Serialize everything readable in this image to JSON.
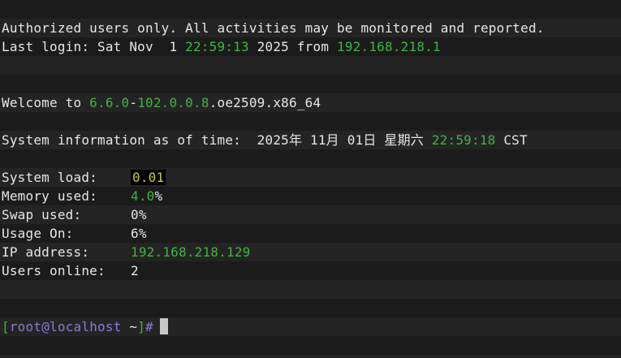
{
  "banner": {
    "warning": "Authorized users only. All activities may be monitored and reported.",
    "last_login_prefix": "Last login: Sat Nov  1 ",
    "last_login_time": "22:59:13",
    "last_login_mid": " 2025 from ",
    "last_login_ip": "192.168.218.1"
  },
  "welcome": {
    "prefix": "Welcome to ",
    "kernel_a": "6.6.0",
    "sep1": "-",
    "kernel_b": "102.0.0.8",
    "suffix": ".oe2509.x86_64"
  },
  "sysinfo": {
    "prefix": "System information as of time:  2025年 11月 01日 星期六 ",
    "time": "22:59:18",
    "tz": " CST"
  },
  "stats": {
    "load_label": "System load:",
    "load_value": "0.01",
    "memory_label": "Memory used:",
    "memory_value": "4.0",
    "memory_unit": "%",
    "swap_label": "Swap used:",
    "swap_value": "0%",
    "usage_label": "Usage On:",
    "usage_value": "6%",
    "ip_label": "IP address:",
    "ip_value": "192.168.218.129",
    "users_label": "Users online:",
    "users_value": "2"
  },
  "prompt": {
    "open": "[",
    "user": "root",
    "at": "@",
    "host": "localhost",
    "path": " ~",
    "close": "]",
    "hash": "#"
  },
  "colors": {
    "background": "#1b1b1b",
    "stripe": "#242424",
    "green": "#3fb43f",
    "yellow": "#c8c840",
    "purple": "#8a7ad6",
    "text": "#e6e6e6"
  }
}
